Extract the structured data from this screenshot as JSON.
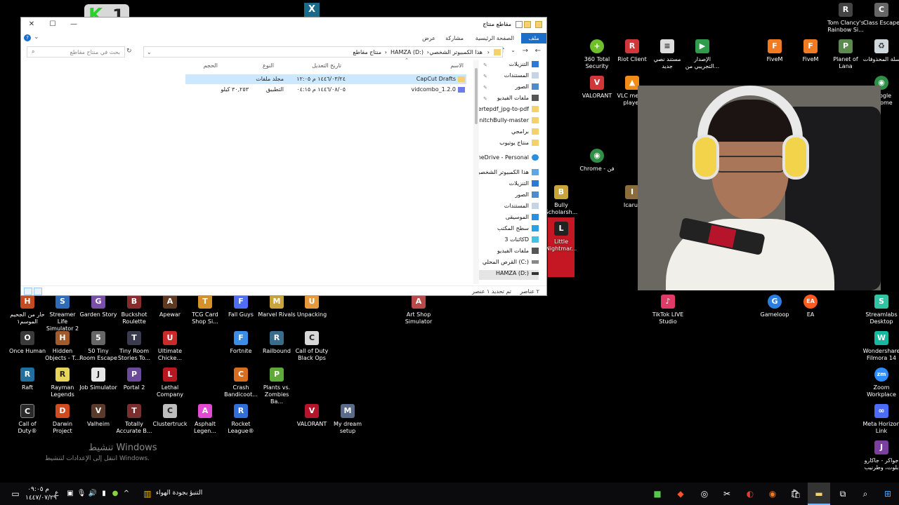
{
  "window": {
    "title": "مقاطع منتاج",
    "ribbon_tabs": [
      "ملف",
      "الصفحة الرئيسية",
      "مشاركة",
      "عرض"
    ],
    "breadcrumb": [
      "هذا الكمبيوتر الشخصي",
      "HAMZA (D:)",
      "منتاج مقاطع"
    ],
    "search_placeholder": "بحث في منتاج مقاطع",
    "columns": {
      "name": "الاسم",
      "date": "تاريخ التعديل",
      "type": "النوع",
      "size": "الحجم"
    },
    "files": [
      {
        "name": "CapCut Drafts",
        "date": "١٤٤٦/٠٣/٢٤ م ١٢:٠٥",
        "type": "مجلد ملفات",
        "size": "",
        "selected": true
      },
      {
        "name": "vidcombo_1.2.0",
        "date": "١٤٤٦/٠٨/٠٥ م ٠٤:١٥",
        "type": "التطبيق",
        "size": "٣٠,٢٥٣ كيلو",
        "selected": false
      }
    ],
    "nav_items": [
      {
        "label": "التنزيلات",
        "pinned": true,
        "icon": "download-icon"
      },
      {
        "label": "المستندات",
        "pinned": true,
        "icon": "document-icon"
      },
      {
        "label": "الصور",
        "pinned": true,
        "icon": "image-icon"
      },
      {
        "label": "ملفات الفيديو",
        "pinned": true,
        "icon": "video-icon"
      },
      {
        "label": "convertepdf_jpg-to-pdf",
        "pinned": false,
        "icon": "folder-icon"
      },
      {
        "label": "SnitchBully-master",
        "pinned": false,
        "icon": "folder-icon"
      },
      {
        "label": "برامجي",
        "pinned": false,
        "icon": "folder-icon"
      },
      {
        "label": "منتاج يوتيوب",
        "pinned": false,
        "icon": "folder-icon"
      },
      {
        "label": "OneDrive - Personal",
        "pinned": false,
        "icon": "cloud-icon"
      },
      {
        "label": "هذا الكمبيوتر الشخصي",
        "pinned": false,
        "icon": "computer-icon"
      },
      {
        "label": "التنزيلات",
        "pinned": false,
        "icon": "download-icon"
      },
      {
        "label": "الصور",
        "pinned": false,
        "icon": "image-icon"
      },
      {
        "label": "المستندات",
        "pinned": false,
        "icon": "document-icon"
      },
      {
        "label": "الموسيقى",
        "pinned": false,
        "icon": "music-icon"
      },
      {
        "label": "سطح المكتب",
        "pinned": false,
        "icon": "desktop-icon"
      },
      {
        "label": "كائنات 3D",
        "pinned": false,
        "icon": "cube-icon"
      },
      {
        "label": "ملفات الفيديو",
        "pinned": false,
        "icon": "video-icon"
      },
      {
        "label": "القرص المحلي (C:)",
        "pinned": false,
        "icon": "drive-icon"
      },
      {
        "label": "HAMZA (D:)",
        "pinned": false,
        "icon": "drive-icon"
      }
    ],
    "status_count": "٢ عناصر",
    "status_selected": "تم تحديد ١ عنصر"
  },
  "desktop_icons": [
    {
      "label": "Tom Clancy's Rainbow Si...",
      "color": "#444444",
      "glyph": "R"
    },
    {
      "label": "Class Escape",
      "color": "#666666",
      "glyph": "C"
    },
    {
      "label": "360 Total Security",
      "color": "#6fbf2a",
      "glyph": "+"
    },
    {
      "label": "Riot Client",
      "color": "#d13639",
      "glyph": "R"
    },
    {
      "label": "مستند نصي جديد",
      "color": "#dddddd",
      "glyph": "≡"
    },
    {
      "label": "الإصدار التجريبي من...",
      "color": "#2e9c4a",
      "glyph": "▶"
    },
    {
      "label": "FiveM",
      "color": "#f07b22",
      "glyph": "F"
    },
    {
      "label": "FiveM",
      "color": "#f07b22",
      "glyph": "F"
    },
    {
      "label": "Planet of Lana",
      "color": "#5d8a4e",
      "glyph": "P"
    },
    {
      "label": "سلة المحذوفات",
      "color": "#cfd8dc",
      "glyph": "🗑"
    },
    {
      "label": "VALORANT",
      "color": "#d13639",
      "glyph": "V"
    },
    {
      "label": "VLC media player",
      "color": "#f28c18",
      "glyph": "▲"
    },
    {
      "label": "Google Chrome",
      "color": "#2f8f46",
      "glyph": "◉"
    },
    {
      "label": "Chrome - فن",
      "color": "#2f8f46",
      "glyph": "◉"
    },
    {
      "label": "Bully Scholarsh...",
      "color": "#c8a43c",
      "glyph": "B"
    },
    {
      "label": "Little Nightmar...",
      "color": "#c41723",
      "glyph": "L"
    },
    {
      "label": "Icarus",
      "color": "#8a6d3b",
      "glyph": "I"
    },
    {
      "label": "TikTok LIVE Studio",
      "color": "#e03a67",
      "glyph": "♪"
    },
    {
      "label": "Gameloop",
      "color": "#2b7de0",
      "glyph": "G"
    },
    {
      "label": "EA",
      "color": "#ff5a1f",
      "glyph": "EA"
    },
    {
      "label": "Streamlabs Desktop",
      "color": "#31c3a2",
      "glyph": "S"
    },
    {
      "label": "Wondershare Filmora 14",
      "color": "#16b8a0",
      "glyph": "W"
    },
    {
      "label": "Zoom Workplace",
      "color": "#2d8cff",
      "glyph": "zm"
    },
    {
      "label": "Meta Horizon Link",
      "color": "#4a6cf7",
      "glyph": "∞"
    },
    {
      "label": "جواكر - جاكارو بلوت، وطرنيب",
      "color": "#7b3fa0",
      "glyph": "J"
    },
    {
      "label": "حار من الجحيم الموسم١",
      "color": "#c44b1f",
      "glyph": "H"
    },
    {
      "label": "Streamer Life Simulator 2",
      "color": "#2f6bb8",
      "glyph": "S"
    },
    {
      "label": "Garden Story",
      "color": "#7a4fa8",
      "glyph": "G"
    },
    {
      "label": "Buckshot Roulette",
      "color": "#8a2b2b",
      "glyph": "B"
    },
    {
      "label": "Apewar",
      "color": "#5e3a22",
      "glyph": "A"
    },
    {
      "label": "TCG Card Shop Si...",
      "color": "#d6912a",
      "glyph": "T"
    },
    {
      "label": "Fall Guys",
      "color": "#4f6df5",
      "glyph": "F"
    },
    {
      "label": "Marvel Rivals",
      "color": "#c9a43a",
      "glyph": "M"
    },
    {
      "label": "Unpacking",
      "color": "#e79a3d",
      "glyph": "U"
    },
    {
      "label": "Art Shop Simulator",
      "color": "#b84a4a",
      "glyph": "A"
    },
    {
      "label": "Once Human",
      "color": "#3a3a3a",
      "glyph": "O"
    },
    {
      "label": "Hidden Objects - T...",
      "color": "#a05a2c",
      "glyph": "H"
    },
    {
      "label": "50 Tiny Room Escape",
      "color": "#666666",
      "glyph": "5"
    },
    {
      "label": "Tiny Room Stories To...",
      "color": "#3b3b4f",
      "glyph": "T"
    },
    {
      "label": "Ultimate Chicke...",
      "color": "#c92a2a",
      "glyph": "U"
    },
    {
      "label": "Fortnite",
      "color": "#3c8de6",
      "glyph": "F"
    },
    {
      "label": "Railbound",
      "color": "#3a6b8a",
      "glyph": "R"
    },
    {
      "label": "Call of Duty Black Ops",
      "color": "#d7d7d7",
      "glyph": "C"
    },
    {
      "label": "Raft",
      "color": "#1f6f9f",
      "glyph": "R"
    },
    {
      "label": "Rayman Legends",
      "color": "#e8d45a",
      "glyph": "R"
    },
    {
      "label": "Job Simulator",
      "color": "#e6e6e6",
      "glyph": "J"
    },
    {
      "label": "Portal 2",
      "color": "#6c4a9a",
      "glyph": "P"
    },
    {
      "label": "Lethal Company",
      "color": "#b8171f",
      "glyph": "L"
    },
    {
      "label": "Crash Bandicoot...",
      "color": "#d66d1f",
      "glyph": "C"
    },
    {
      "label": "Plants vs. Zombies Ba...",
      "color": "#5fa83a",
      "glyph": "P"
    },
    {
      "label": "Call of Duty®",
      "color": "#2a2a2a",
      "glyph": "C"
    },
    {
      "label": "Darwin Project",
      "color": "#d24a1f",
      "glyph": "D"
    },
    {
      "label": "Valheim",
      "color": "#5a3a2a",
      "glyph": "V"
    },
    {
      "label": "Totally Accurate B...",
      "color": "#7a2f2f",
      "glyph": "T"
    },
    {
      "label": "Clustertruck",
      "color": "#bdbdbd",
      "glyph": "C"
    },
    {
      "label": "Asphalt Legen...",
      "color": "#e14ad1",
      "glyph": "A"
    },
    {
      "label": "Rocket League®",
      "color": "#2f6fd6",
      "glyph": "R"
    },
    {
      "label": "VALORANT",
      "color": "#b5142a",
      "glyph": "V"
    },
    {
      "label": "My dream setup",
      "color": "#5a6b8a",
      "glyph": "M"
    }
  ],
  "watermark": {
    "title": "تنشيط Windows",
    "subtitle": "انتقل إلى الإعدادات لتنشيط Windows."
  },
  "taskbar": {
    "time": "م ٠٩:٠٥",
    "date": "١٤٤٧/٠٧/٢٩",
    "lang": "ع",
    "weather": "التنبؤ بجودة الهواء"
  }
}
